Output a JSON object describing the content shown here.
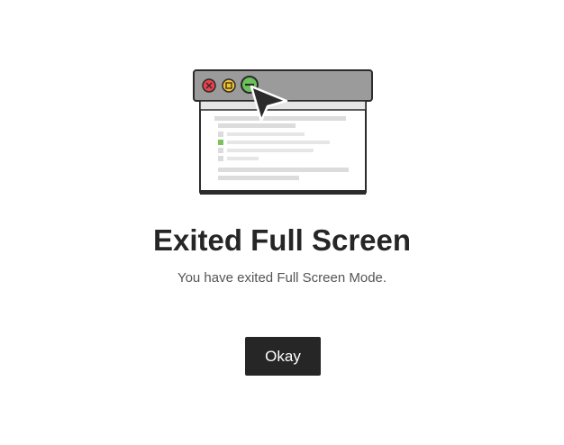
{
  "dialog": {
    "title": "Exited Full Screen",
    "message": "You have exited Full Screen Mode.",
    "okay_label": "Okay"
  },
  "illustration": {
    "icons": [
      "close-icon",
      "minimize-icon",
      "fullscreen-exit-icon",
      "cursor-icon"
    ],
    "colors": {
      "titlebar": "#9b9b9b",
      "close": "#e9404b",
      "minimize": "#f2c12e",
      "fullscreen": "#6ac259",
      "outline": "#2b2b2b",
      "line": "#dcdcdc",
      "accent": "#7cc35e"
    }
  }
}
